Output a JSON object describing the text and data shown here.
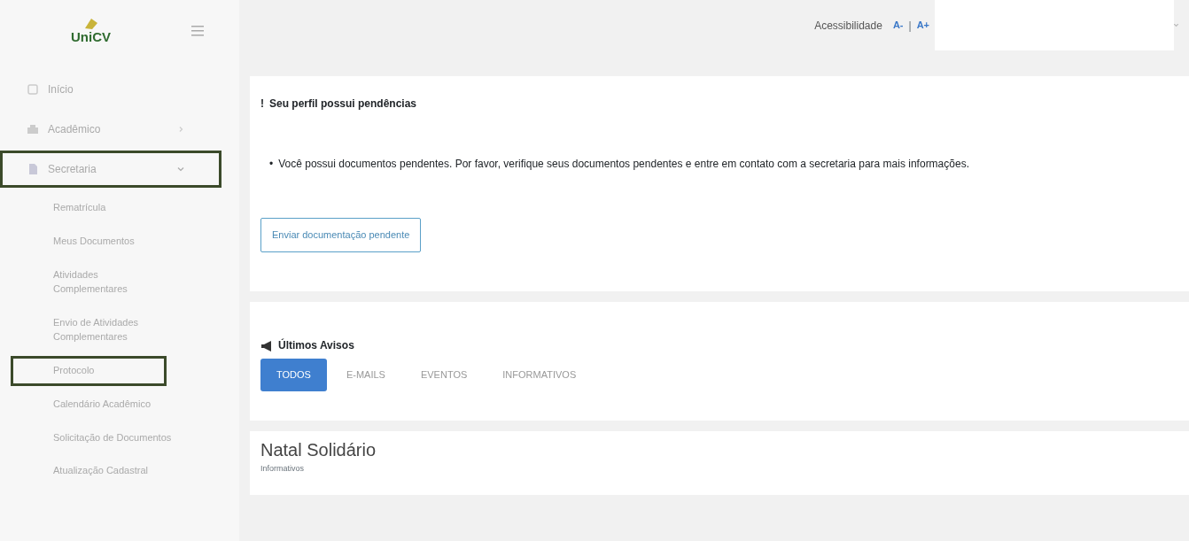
{
  "logo": {
    "text": "UniCV"
  },
  "header": {
    "accessibility_label": "Acessibilidade",
    "decrease": "A-",
    "separator": "|",
    "increase": "A+"
  },
  "sidebar": {
    "items": [
      {
        "label": "Início",
        "kind": "home",
        "highlighted": false
      },
      {
        "label": "Acadêmico",
        "kind": "building",
        "expanded": false,
        "highlighted": false
      },
      {
        "label": "Secretaria",
        "kind": "document",
        "expanded": true,
        "highlighted": true,
        "children": [
          {
            "label": "Rematrícula",
            "highlighted": false
          },
          {
            "label": "Meus Documentos",
            "highlighted": false
          },
          {
            "label": "Atividades Complementares",
            "highlighted": false
          },
          {
            "label": "Envio de Atividades Complementares",
            "highlighted": false
          },
          {
            "label": "Protocolo",
            "highlighted": true
          },
          {
            "label": "Calendário Acadêmico",
            "highlighted": false
          },
          {
            "label": "Solicitação de Documentos",
            "highlighted": false
          },
          {
            "label": "Atualização Cadastral",
            "highlighted": false
          }
        ]
      }
    ]
  },
  "pending": {
    "mark": "!",
    "title": "Seu perfil possui pendências",
    "bullet": "•",
    "items": [
      "Você possui documentos pendentes. Por favor, verifique seus documentos pendentes e entre em contato com a secretaria para mais informações."
    ],
    "button": "Enviar documentação pendente"
  },
  "notices": {
    "title": "Últimos Avisos",
    "tabs": [
      {
        "label": "TODOS",
        "selected": true
      },
      {
        "label": "E-MAILS",
        "selected": false
      },
      {
        "label": "EVENTOS",
        "selected": false
      },
      {
        "label": "INFORMATIVOS",
        "selected": false
      }
    ]
  },
  "posts": [
    {
      "title": "Natal Solidário",
      "category": "Informativos"
    }
  ]
}
